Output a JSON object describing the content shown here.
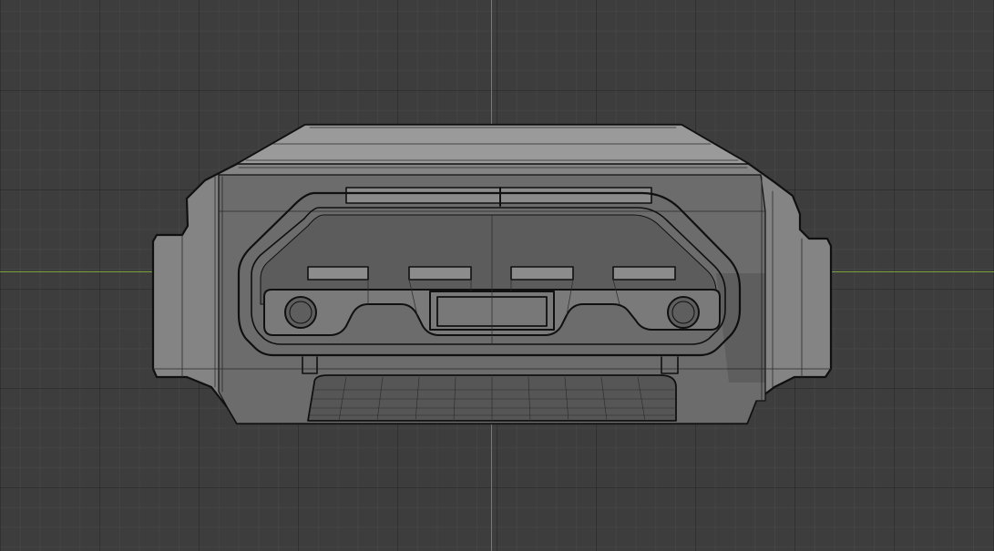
{
  "viewport": {
    "background": "#3d3d3d",
    "axis_x_color": "#7aa23a",
    "axis_y_color": "#4f7fbf"
  },
  "model": {
    "icon": "hdmi-port-mesh",
    "body_color": "#848484",
    "face_color": "#6c6c6c",
    "top_face_color": "#9a9a9a",
    "edge_color": "#101010",
    "wire_color": "#2a2a2a"
  }
}
